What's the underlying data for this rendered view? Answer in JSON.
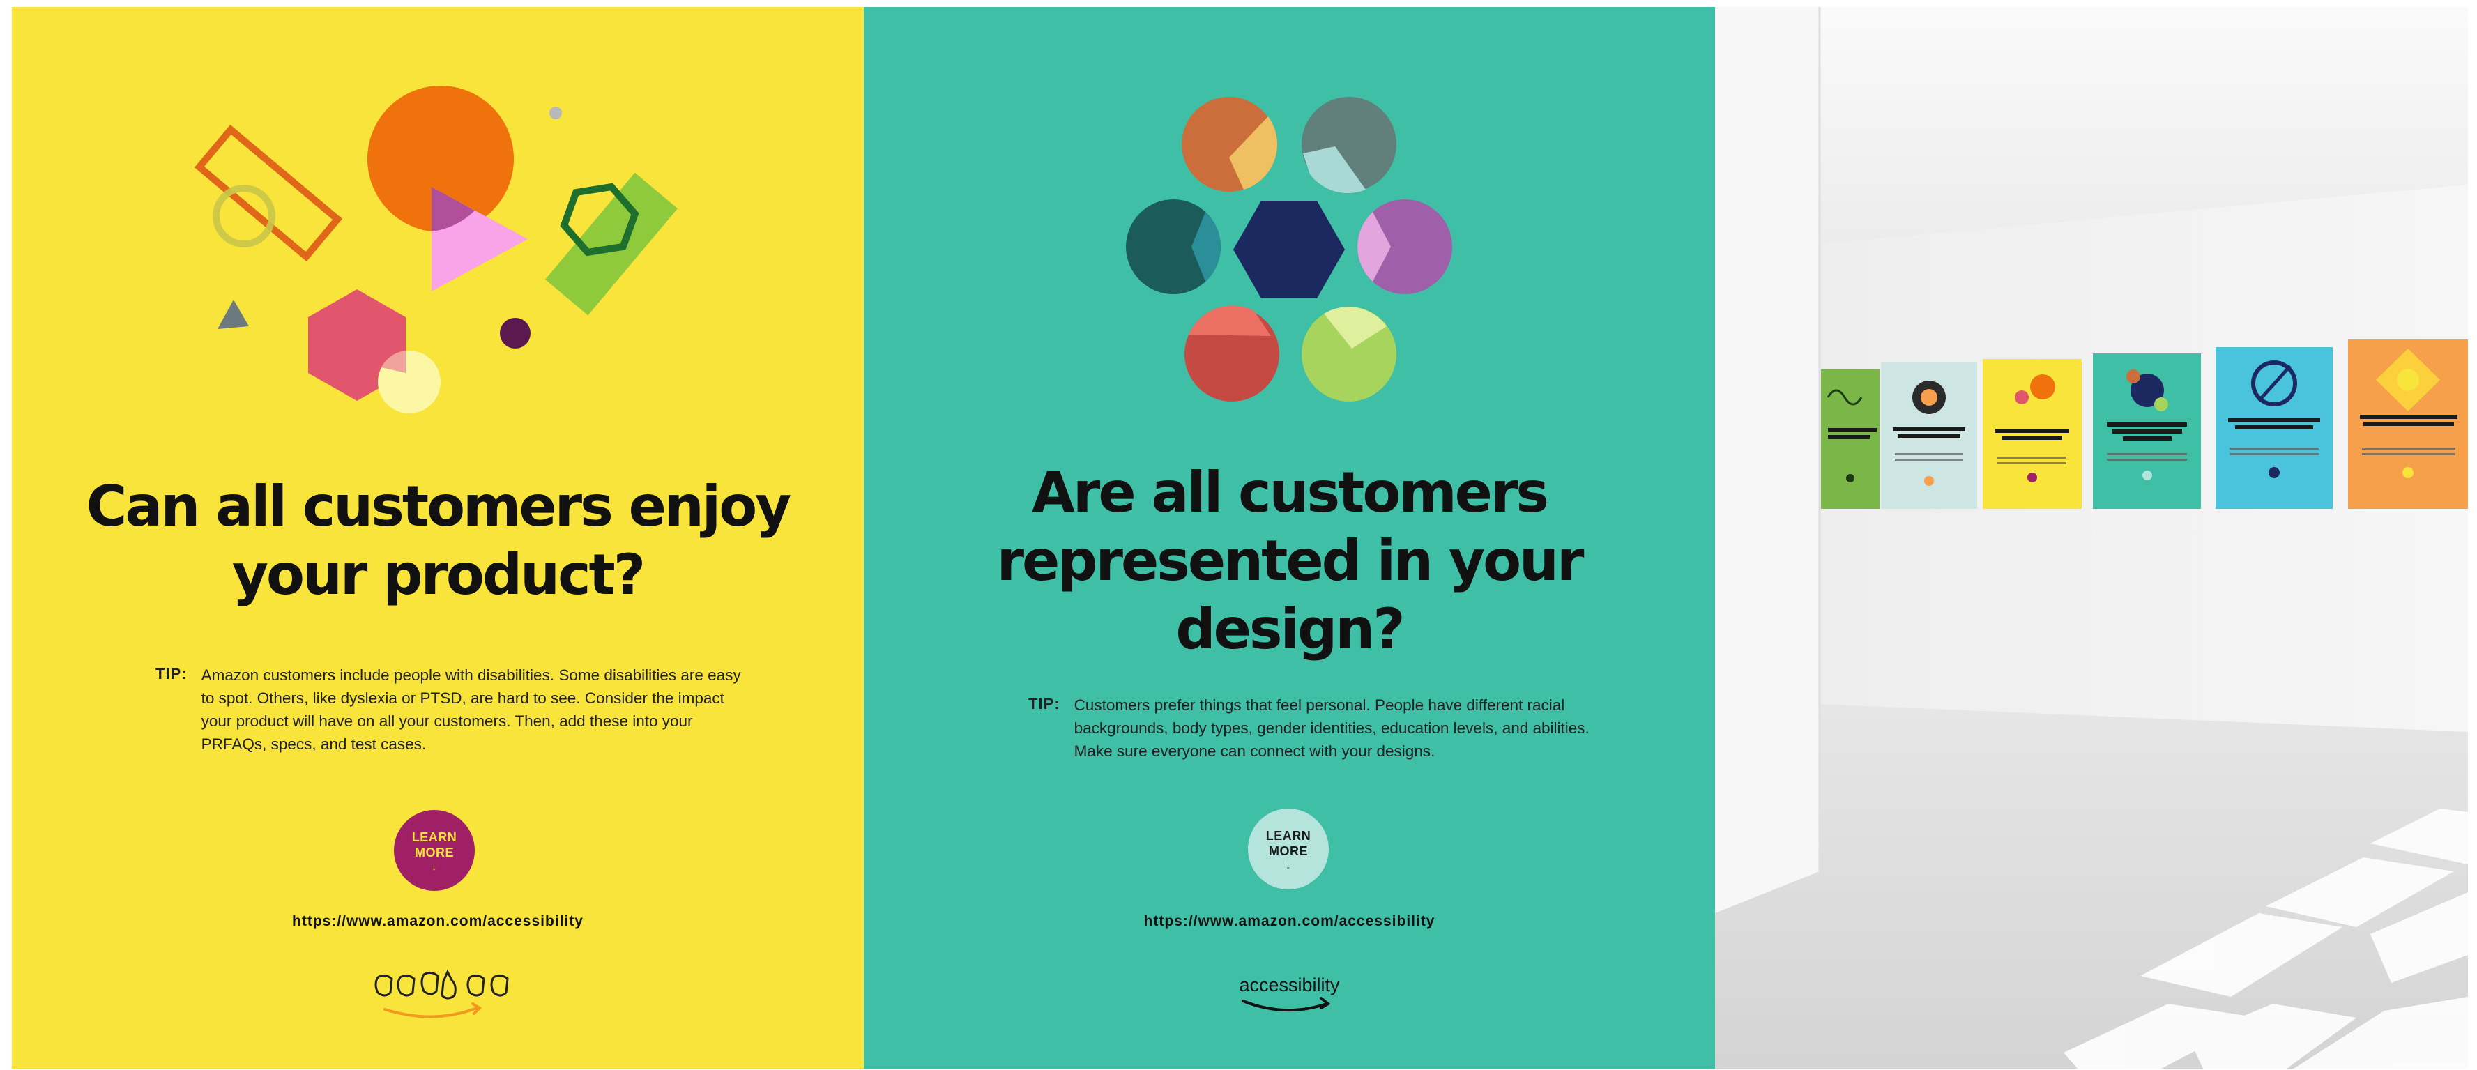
{
  "panels": {
    "enjoy": {
      "headline_line1": "Can all customers enjoy",
      "headline_line2": "your product?",
      "tip_label": "TIP:",
      "tip_text": "Amazon customers include people with disabilities. Some disabilities are easy to spot. Others, like dyslexia or PTSD, are hard to see. Consider the impact your product will have on all your customers. Then, add these into your PRFAQs, specs, and test cases.",
      "learn_line1": "LEARN",
      "learn_line2": "MORE",
      "url": "https://www.amazon.com/accessibility",
      "background": "#f8e43a",
      "accent": "#a02066"
    },
    "represented": {
      "headline_line1": "Are all customers",
      "headline_line2": "represented in your",
      "headline_line3": "design?",
      "tip_label": "TIP:",
      "tip_text": "Customers prefer things that feel personal. People have different racial backgrounds, body types, gender identities, education levels, and abilities. Make sure everyone can connect with your designs.",
      "learn_line1": "LEARN",
      "learn_line2": "MORE",
      "url": "https://www.amazon.com/accessibility",
      "wordmark": "accessibility",
      "background": "#3fbfa6",
      "accent": "#b4e4dc"
    },
    "gallery": {
      "description_icon": "gallery-wall-of-posters",
      "poster_colors": [
        "#7ab648",
        "#cde6e4",
        "#f8e43a",
        "#3fbfa6",
        "#4ac3dd",
        "#f7a04b"
      ]
    }
  },
  "icons": {
    "arrow": "↓",
    "logo": "sign-language-hands-logo",
    "smile": "amazon-smile-arrow"
  }
}
